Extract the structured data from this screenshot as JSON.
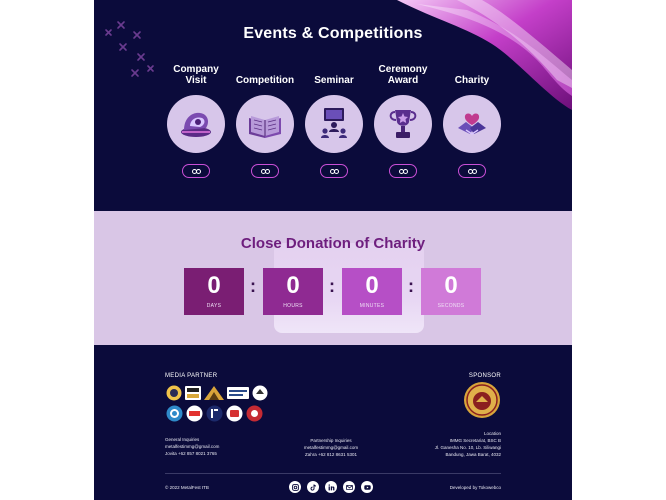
{
  "events": {
    "title": "Events & Competitions",
    "cards": [
      {
        "label_line1": "Company",
        "label_line2": "Visit",
        "icon": "company-visit-icon"
      },
      {
        "label_line1": "",
        "label_line2": "Competition",
        "icon": "open-book-icon"
      },
      {
        "label_line1": "",
        "label_line2": "Seminar",
        "icon": "seminar-audience-icon"
      },
      {
        "label_line1": "Ceremony",
        "label_line2": "Award",
        "icon": "trophy-icon"
      },
      {
        "label_line1": "",
        "label_line2": "Charity",
        "icon": "handshake-heart-icon"
      }
    ],
    "button_icon": "link-icon"
  },
  "countdown": {
    "title": "Close Donation of Charity",
    "boxes": [
      {
        "value": "0",
        "unit": "DAYS",
        "color": "#7a1e73"
      },
      {
        "value": "0",
        "unit": "HOURS",
        "color": "#8f2a92"
      },
      {
        "value": "0",
        "unit": "MINUTES",
        "color": "#b64fc6"
      },
      {
        "value": "0",
        "unit": "SECONDS",
        "color": "#d07ad8"
      }
    ],
    "separator": ":"
  },
  "footer": {
    "media_partner_heading": "MEDIA PARTNER",
    "sponsor_heading": "SPONSOR",
    "general_inquiries": {
      "title": "General Inquiries",
      "email": "metalfestimmg@gmail.com",
      "phone": "Jovita +62 857 8021 3765"
    },
    "partnership_inquiries": {
      "title": "Partnership Inquiries",
      "email": "metalfestimmg@gmail.com",
      "phone": "Zahra +62 812 8631 5301"
    },
    "location": {
      "title": "Location",
      "line1": "IMMG Secretariat, BSC B",
      "line2": "Jl. Ganesha No. 10, Lb. Siliwangi",
      "line3": "Bandung, Jawa Barat, 4032"
    },
    "copyright": "© 2022 MetalFest ITB",
    "developed_by": "Developed by Tokowebco",
    "socials": [
      "instagram-icon",
      "tiktok-icon",
      "linkedin-icon",
      "email-icon",
      "youtube-icon"
    ]
  },
  "colors": {
    "navy": "#0b0b3b",
    "lavender": "#d9c6e6",
    "title_purple": "#6e1e7e",
    "accent_magenta": "#c94fd6"
  }
}
